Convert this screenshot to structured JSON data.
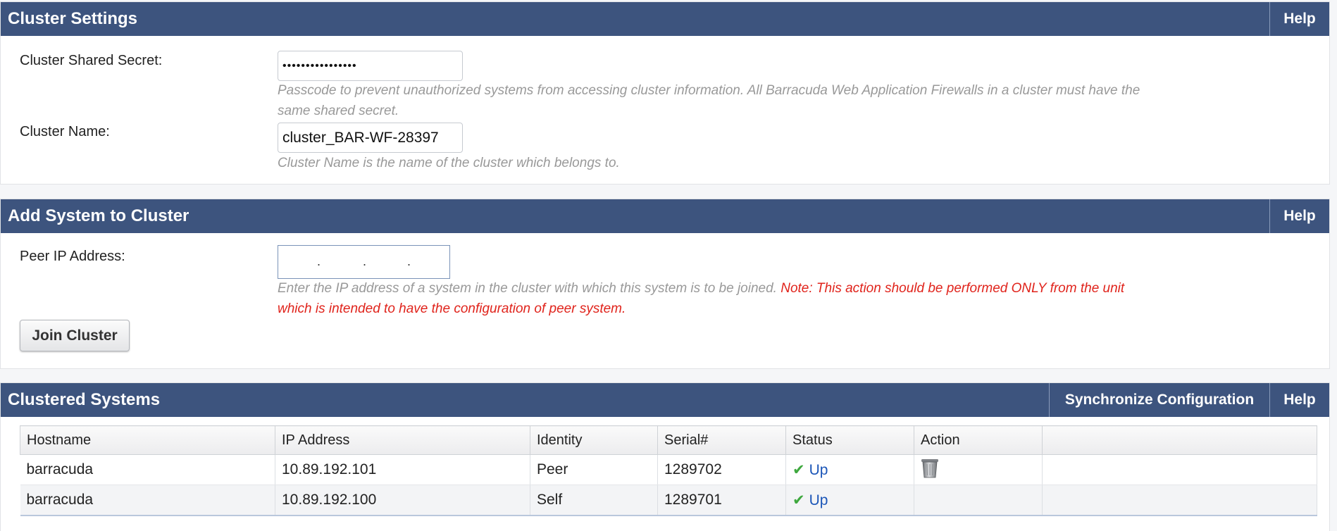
{
  "cluster_settings": {
    "title": "Cluster Settings",
    "help_label": "Help",
    "shared_secret": {
      "label": "Cluster Shared Secret:",
      "value": "••••••••••••••••",
      "hint": "Passcode to prevent unauthorized systems from accessing cluster information. All Barracuda Web Application Firewalls in a cluster must have the same shared secret."
    },
    "cluster_name": {
      "label": "Cluster Name:",
      "value": "cluster_BAR-WF-28397",
      "hint": "Cluster Name is the name of the cluster which belongs to."
    }
  },
  "add_system": {
    "title": "Add System to Cluster",
    "help_label": "Help",
    "peer_ip": {
      "label": "Peer IP Address:",
      "dots": [
        ".",
        ".",
        "."
      ],
      "hint": "Enter the IP address of a system in the cluster with which this system is to be joined.",
      "warning": "Note: This action should be performed ONLY from the unit which is intended to have the configuration of peer system."
    },
    "join_label": "Join Cluster"
  },
  "clustered_systems": {
    "title": "Clustered Systems",
    "sync_label": "Synchronize Configuration",
    "help_label": "Help",
    "columns": [
      "Hostname",
      "IP Address",
      "Identity",
      "Serial#",
      "Status",
      "Action",
      ""
    ],
    "rows": [
      {
        "hostname": "barracuda",
        "ip": "10.89.192.101",
        "identity": "Peer",
        "serial": "1289702",
        "status": "Up",
        "action_icon": "trash-icon"
      },
      {
        "hostname": "barracuda",
        "ip": "10.89.192.100",
        "identity": "Self",
        "serial": "1289701",
        "status": "Up",
        "action_icon": ""
      }
    ]
  },
  "colors": {
    "header_bg": "#3d547e",
    "warning": "#e0231b",
    "link": "#1c56b8",
    "check": "#3ea83e"
  }
}
